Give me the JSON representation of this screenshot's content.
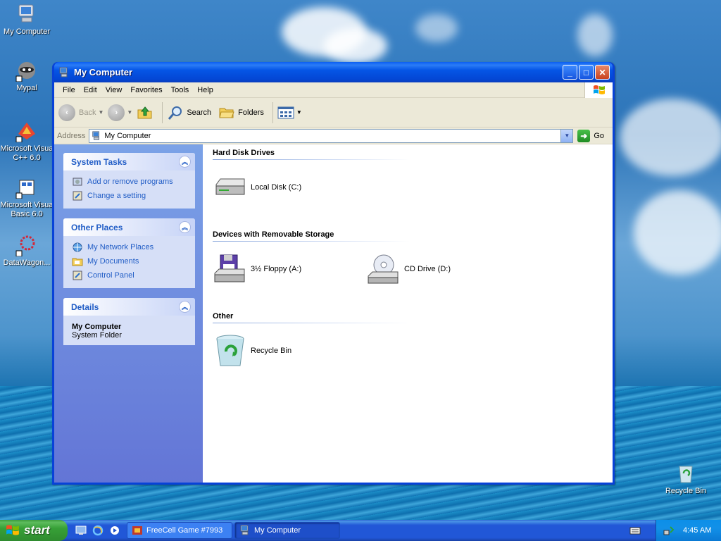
{
  "desktop": {
    "icons": [
      {
        "label": "My Computer"
      },
      {
        "label": "Mypal"
      },
      {
        "label": "Microsoft Visua C++ 6.0"
      },
      {
        "label": "Microsoft Visua Basic 6.0"
      },
      {
        "label": "DataWagon..."
      },
      {
        "label": "Recycle Bin"
      }
    ]
  },
  "window": {
    "title": "My Computer",
    "menu": [
      "File",
      "Edit",
      "View",
      "Favorites",
      "Tools",
      "Help"
    ],
    "toolbar": {
      "back_label": "Back",
      "search_label": "Search",
      "folders_label": "Folders"
    },
    "address": {
      "label": "Address",
      "value": "My Computer",
      "go_label": "Go"
    },
    "left_pane": {
      "system_tasks": {
        "title": "System Tasks",
        "links": [
          "Add or remove programs",
          "Change a setting"
        ]
      },
      "other_places": {
        "title": "Other Places",
        "links": [
          "My Network Places",
          "My Documents",
          "Control Panel"
        ]
      },
      "details": {
        "title": "Details",
        "name": "My Computer",
        "type": "System Folder"
      }
    },
    "groups": {
      "hard_disk": {
        "title": "Hard Disk Drives",
        "items": [
          "Local Disk (C:)"
        ]
      },
      "removable": {
        "title": "Devices with Removable Storage",
        "items": [
          "3½ Floppy (A:)",
          "CD Drive (D:)"
        ]
      },
      "other": {
        "title": "Other",
        "items": [
          "Recycle Bin"
        ]
      }
    }
  },
  "taskbar": {
    "start_label": "start",
    "tasks": [
      "FreeCell Game #7993",
      "My Computer"
    ],
    "clock": "4:45 AM"
  }
}
